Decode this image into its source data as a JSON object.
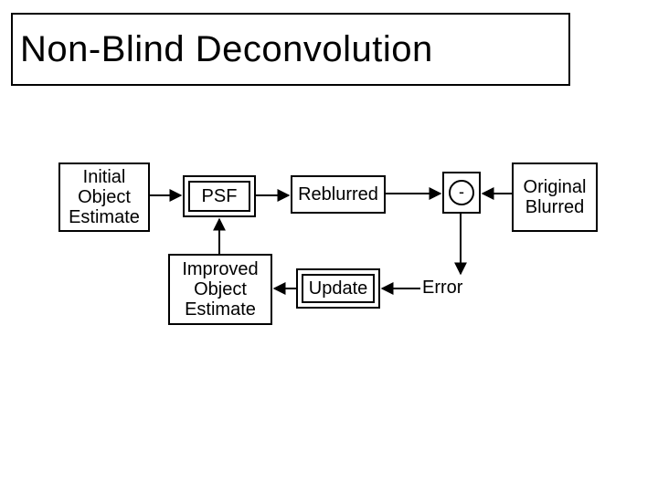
{
  "title": "Non-Blind Deconvolution",
  "nodes": {
    "initial": "Initial\nObject\nEstimate",
    "psf": "PSF",
    "reblur": "Reblurred",
    "minus": "-",
    "original": "Original\nBlurred",
    "improved": "Improved\nObject\nEstimate",
    "update": "Update",
    "error": "Error"
  }
}
